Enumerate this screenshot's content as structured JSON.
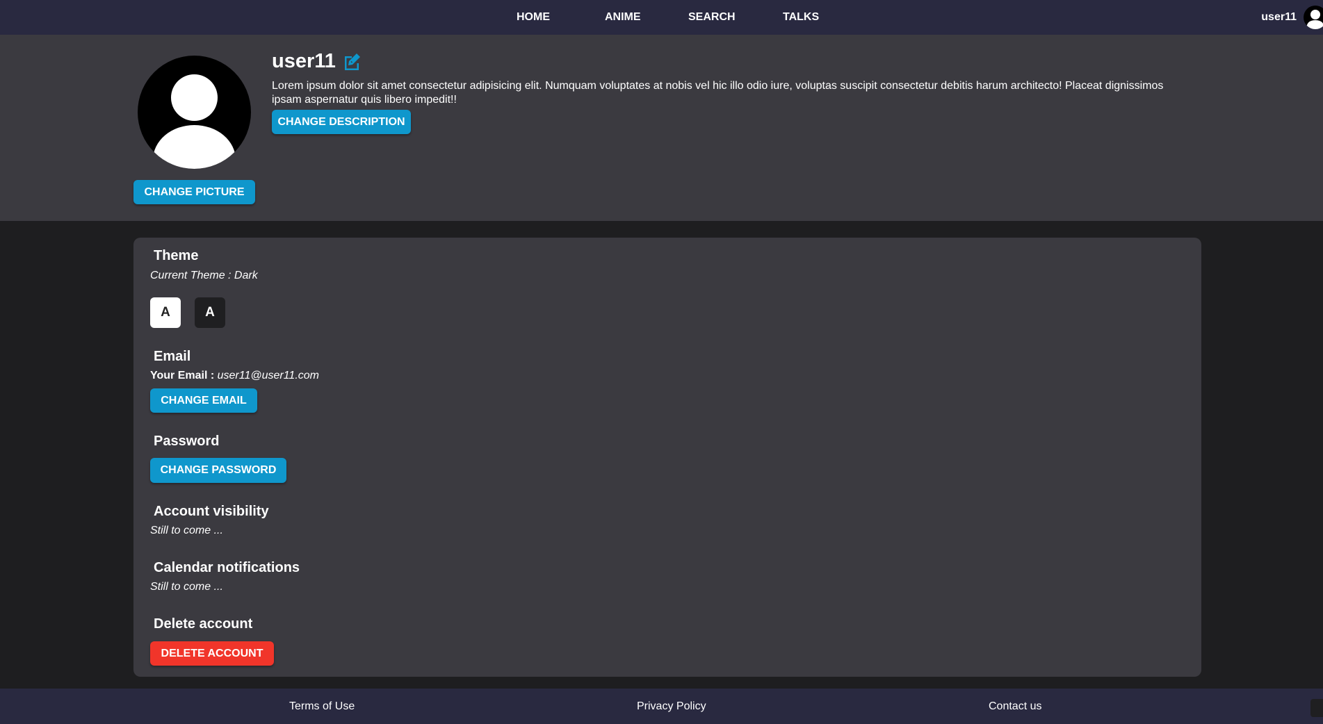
{
  "navbar": {
    "links": [
      "HOME",
      "ANIME",
      "SEARCH",
      "TALKS"
    ],
    "username": "user11"
  },
  "profile": {
    "username": "user11",
    "description": "Lorem ipsum dolor sit amet consectetur adipisicing elit. Numquam voluptates at nobis vel hic illo odio iure, voluptas suscipit consectetur debitis harum architecto! Placeat dignissimos ipsam aspernatur quis libero impedit!!",
    "change_description_label": "CHANGE DESCRIPTION",
    "change_picture_label": "CHANGE PICTURE"
  },
  "settings": {
    "theme": {
      "title": "Theme",
      "current": "Current Theme : Dark",
      "light_label": "A",
      "dark_label": "A"
    },
    "email": {
      "title": "Email",
      "label": "Your Email : ",
      "value": "user11@user11.com",
      "button": "CHANGE EMAIL"
    },
    "password": {
      "title": "Password",
      "button": "CHANGE PASSWORD"
    },
    "visibility": {
      "title": "Account visibility",
      "status": "Still to come ..."
    },
    "calendar": {
      "title": "Calendar notifications",
      "status": "Still to come ..."
    },
    "delete": {
      "title": "Delete account",
      "button": "DELETE ACCOUNT"
    }
  },
  "footer": {
    "links": [
      "Terms of Use",
      "Privacy Policy",
      "Contact us"
    ]
  },
  "colors": {
    "navbar": "#292940",
    "panel": "#3b3a40",
    "background": "#1e1e20",
    "accent": "#0f97cc",
    "danger": "#f1352a"
  },
  "icons": {
    "edit": "edit-icon",
    "avatar": "user-avatar-icon"
  }
}
